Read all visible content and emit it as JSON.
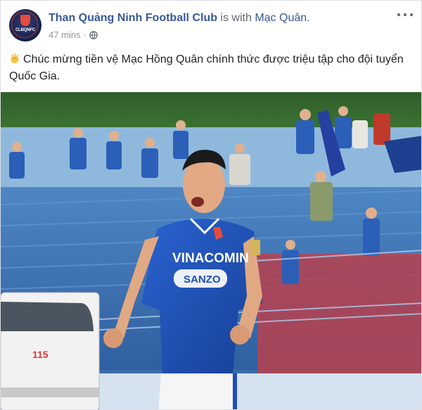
{
  "post": {
    "page_name": "Than Quảng Ninh Football Club",
    "with_text": "is with",
    "tagged_friend": "Mạc Quân.",
    "time": "47 mins",
    "privacy_icon": "globe-icon",
    "text": "Chúc mừng tiền vệ Mạc Hồng Quân chính thức được triệu tập cho đội tuyển Quốc Gia.",
    "emoji_icon": "clapping-hands-icon"
  },
  "avatar": {
    "logo_text": "CLBQNFC"
  },
  "photo": {
    "shirt_sponsor": "VINACOMIN",
    "shirt_sponsor_2": "SANZO",
    "ambulance_number": "115"
  },
  "colors": {
    "link": "#385898",
    "muted": "#90949c",
    "text": "#1d2129",
    "kit_blue": "#1e4fb5"
  }
}
